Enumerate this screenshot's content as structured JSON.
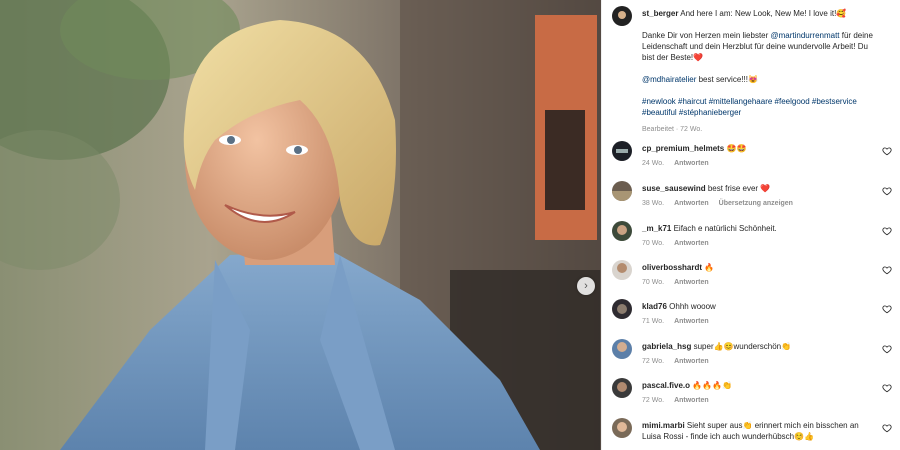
{
  "post": {
    "author": "st_berger",
    "caption_line1": "And here I am: New Look, New Me! I love it!🥰",
    "caption_line2_a": "Danke Dir von Herzen mein liebster ",
    "caption_mention1": "@martindurrenmatt",
    "caption_line2_b": " für deine Leidenschaft und dein Herzblut für deine wundervolle Arbeit! Du bist der Beste!❤️",
    "caption_mention2": "@mdhairatelier",
    "caption_line3": " best service!!!😻",
    "hashtags": "#newlook #haircut #mittellangehaare #feelgood #bestservice #beautiful #stéphanieberger",
    "edited": "Bearbeitet",
    "time": "72 Wo."
  },
  "photo": {
    "next_icon": "›"
  },
  "comments": [
    {
      "user": "cp_premium_helmets",
      "text": "🤩🤩",
      "time": "24 Wo.",
      "reply": "Antworten",
      "extra": ""
    },
    {
      "user": "suse_sausewind",
      "text": "best frise ever ❤️",
      "time": "38 Wo.",
      "reply": "Antworten",
      "extra": "Übersetzung anzeigen"
    },
    {
      "user": "_m_k71",
      "text": "Eifach e natürlichi Schönheit.",
      "time": "70 Wo.",
      "reply": "Antworten",
      "extra": ""
    },
    {
      "user": "oliverbosshardt",
      "text": "🔥",
      "time": "70 Wo.",
      "reply": "Antworten",
      "extra": ""
    },
    {
      "user": "klad76",
      "text": "Ohhh wooow",
      "time": "71 Wo.",
      "reply": "Antworten",
      "extra": ""
    },
    {
      "user": "gabriela_hsg",
      "text": "super👍😊wunderschön👏",
      "time": "72 Wo.",
      "reply": "Antworten",
      "extra": ""
    },
    {
      "user": "pascal.five.o",
      "text": "🔥🔥🔥👏",
      "time": "72 Wo.",
      "reply": "Antworten",
      "extra": ""
    },
    {
      "user": "mimi.marbi",
      "text": "Sieht super aus👏 erinnert mich ein bisschen an Luisa Rossi - finde ich auch wunderhübsch☺️👍",
      "time": "",
      "reply": "",
      "extra": ""
    }
  ],
  "colors": {
    "link": "#00376b",
    "meta": "#8e8e8e",
    "text": "#262626"
  }
}
